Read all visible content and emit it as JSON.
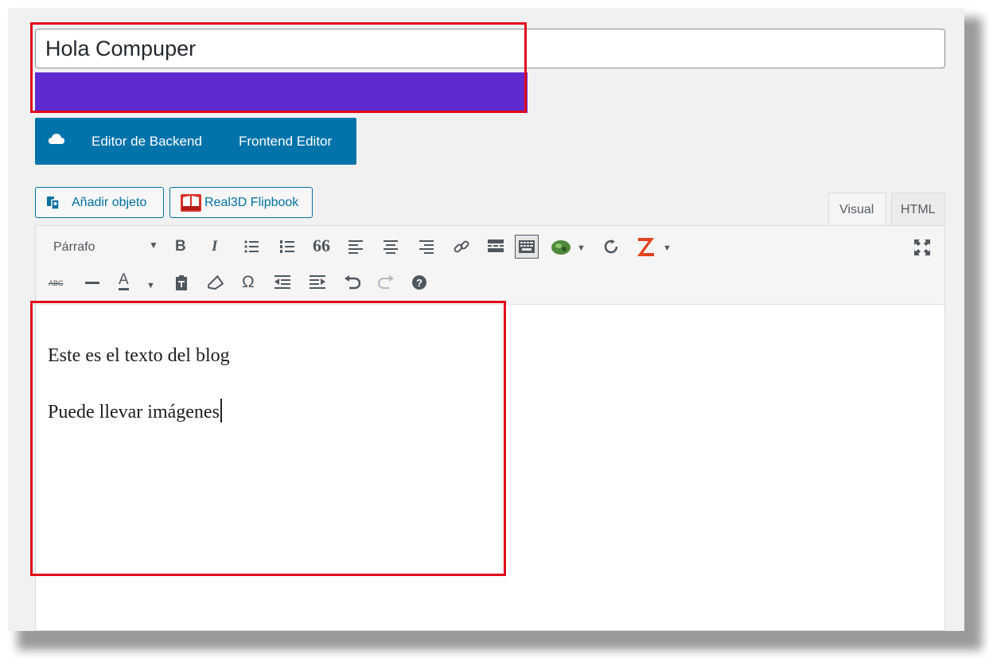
{
  "title_field": {
    "value": "Hola Compuper"
  },
  "page_builder": {
    "backend_label": "Editor de Backend",
    "frontend_label": "Frontend Editor"
  },
  "media_buttons": {
    "add_object_label": "Añadir objeto",
    "flipbook_label": "Real3D Flipbook"
  },
  "editor_tabs": {
    "visual_label": "Visual",
    "html_label": "HTML"
  },
  "toolbar": {
    "format_select_value": "Párrafo",
    "bold_label": "B",
    "italic_label": "I",
    "blockquote_label": "66",
    "strike_label": "ABC",
    "text_color_label": "A",
    "special_char_label": "Ω",
    "icons": [
      "bold-icon",
      "italic-icon",
      "bullet-list-icon",
      "numbered-list-icon",
      "blockquote-icon",
      "align-left-icon",
      "align-center-icon",
      "align-right-icon",
      "link-icon",
      "read-more-icon",
      "toolbar-toggle-icon",
      "plugin-icon",
      "refresh-icon",
      "z-icon",
      "fullscreen-icon",
      "strikethrough-icon",
      "horizontal-line-icon",
      "text-color-icon",
      "paste-text-icon",
      "clear-format-icon",
      "special-character-icon",
      "outdent-icon",
      "indent-icon",
      "undo-icon",
      "redo-icon",
      "help-icon"
    ]
  },
  "content": {
    "paragraphs": [
      "Este es el texto del blog",
      "Puede llevar imágenes"
    ]
  },
  "colors": {
    "highlight_box": "#e20a1a",
    "purple_bar": "#5f2bd1",
    "builder_blue": "#0073aa",
    "z_icon": "#e2401c",
    "plugin_green": "#4e8a3a"
  }
}
